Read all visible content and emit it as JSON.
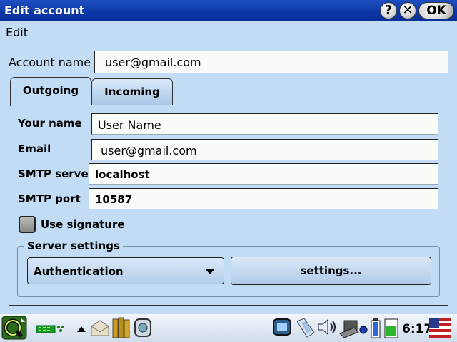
{
  "window": {
    "title": "Edit account",
    "help_label": "?",
    "close_label": "✕",
    "ok_label": "OK"
  },
  "menu": {
    "edit_label": "Edit"
  },
  "account": {
    "label": "Account name",
    "value": "user@gmail.com"
  },
  "tabs": [
    {
      "label": "Outgoing",
      "active": true
    },
    {
      "label": "Incoming",
      "active": false
    }
  ],
  "outgoing": {
    "your_name_label": "Your name",
    "your_name_value": "User Name",
    "email_label": "Email",
    "email_value": "user@gmail.com",
    "smtp_server_label": "SMTP server",
    "smtp_server_value": "localhost",
    "smtp_port_label": "SMTP port",
    "smtp_port_value": "10587",
    "use_signature_label": "Use signature",
    "use_signature_checked": false,
    "server_settings_title": "Server settings",
    "auth_selected": "Authentication",
    "settings_button_label": "settings..."
  },
  "taskbar": {
    "clock": "6:17",
    "icons": [
      "start-menu-icon",
      "network-status-icon",
      "tray-arrow-icon",
      "mail-icon",
      "books-icon",
      "help-viewer-icon",
      "media-icon",
      "connection-icon",
      "volume-icon",
      "laptop-icon",
      "battery-icon",
      "signal-icon",
      "us-flag-icon"
    ]
  },
  "colors": {
    "title_bar": "#0a36a6",
    "background": "#c2dcf6",
    "field_background": "#fafcf8"
  }
}
